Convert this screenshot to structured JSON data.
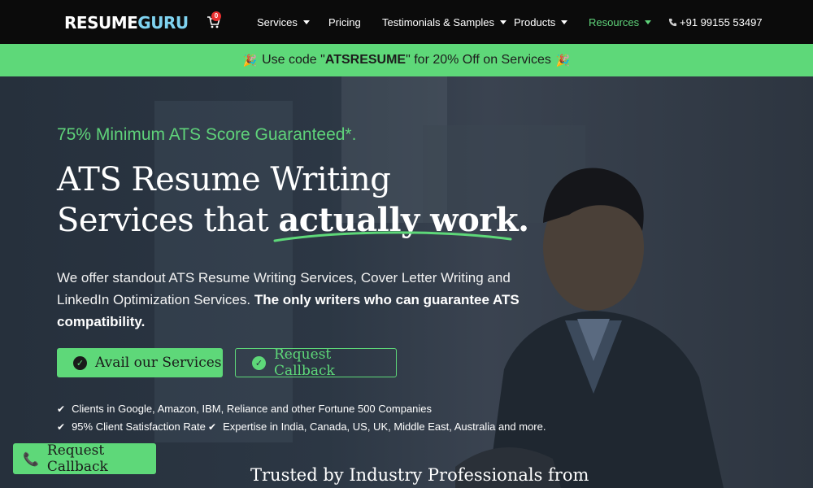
{
  "brand": {
    "part1": "RESUME",
    "part2": "GURU"
  },
  "cart": {
    "count": "0"
  },
  "nav": {
    "services": "Services",
    "pricing": "Pricing",
    "testimonials": "Testimonials & Samples",
    "products": "Products",
    "resources": "Resources",
    "phone": "+91 99155 53497"
  },
  "promo": {
    "before": "Use code \"",
    "code": "ATSRESUME",
    "after": "\" for 20% Off on Services"
  },
  "hero": {
    "tagline": "75% Minimum ATS Score Guaranteed*.",
    "headline_line1": "ATS Resume Writing",
    "headline_line2_plain": "Services that ",
    "headline_line2_bold": "actually work.",
    "desc_plain": "We offer standout ATS Resume Writing Services, Cover Letter Writing and LinkedIn Optimization Services. ",
    "desc_bold": "The only writers who can guarantee ATS compatibility.",
    "primary_button": "Avail our Services",
    "secondary_button": "Request Callback",
    "bullets": [
      "Clients in Google, Amazon, IBM, Reliance and other Fortune 500 Companies",
      "95% Client Satisfaction Rate",
      "Expertise in India, Canada, US, UK, Middle East, Australia and more."
    ]
  },
  "floating_button": "Request Callback",
  "trusted_heading": "Trusted by Industry Professionals from",
  "colors": {
    "accent": "#5ed879",
    "nav_bg": "#0b0b0b",
    "logo_secondary": "#7fd3f0"
  },
  "icons": [
    "cart-icon",
    "caret-down-icon",
    "phone-icon",
    "party-popper-icon",
    "check-circle-icon",
    "check-icon"
  ]
}
